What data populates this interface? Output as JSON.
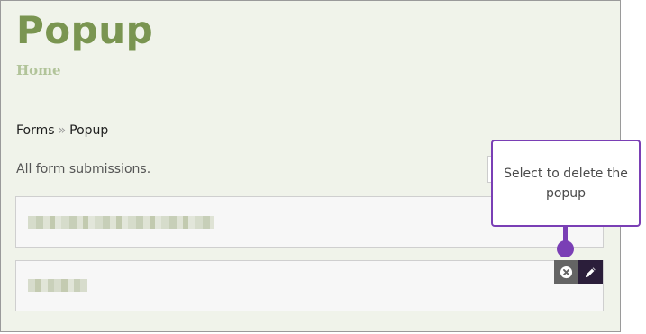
{
  "header": {
    "title": "Popup",
    "home_link": "Home"
  },
  "breadcrumb": {
    "items": [
      "Forms",
      "Popup"
    ],
    "separator": "»"
  },
  "main": {
    "intro": "All form submissions.",
    "entries": [
      {
        "label": ""
      },
      {
        "label": ""
      }
    ]
  },
  "actions": {
    "delete_icon": "close-circle-icon",
    "edit_icon": "pencil-icon"
  },
  "callout": {
    "text": "Select to delete the popup",
    "color": "#7a3fb5"
  },
  "colors": {
    "title": "#7a9551",
    "home": "#b2c49a",
    "panel_bg": "#f0f3ea"
  }
}
